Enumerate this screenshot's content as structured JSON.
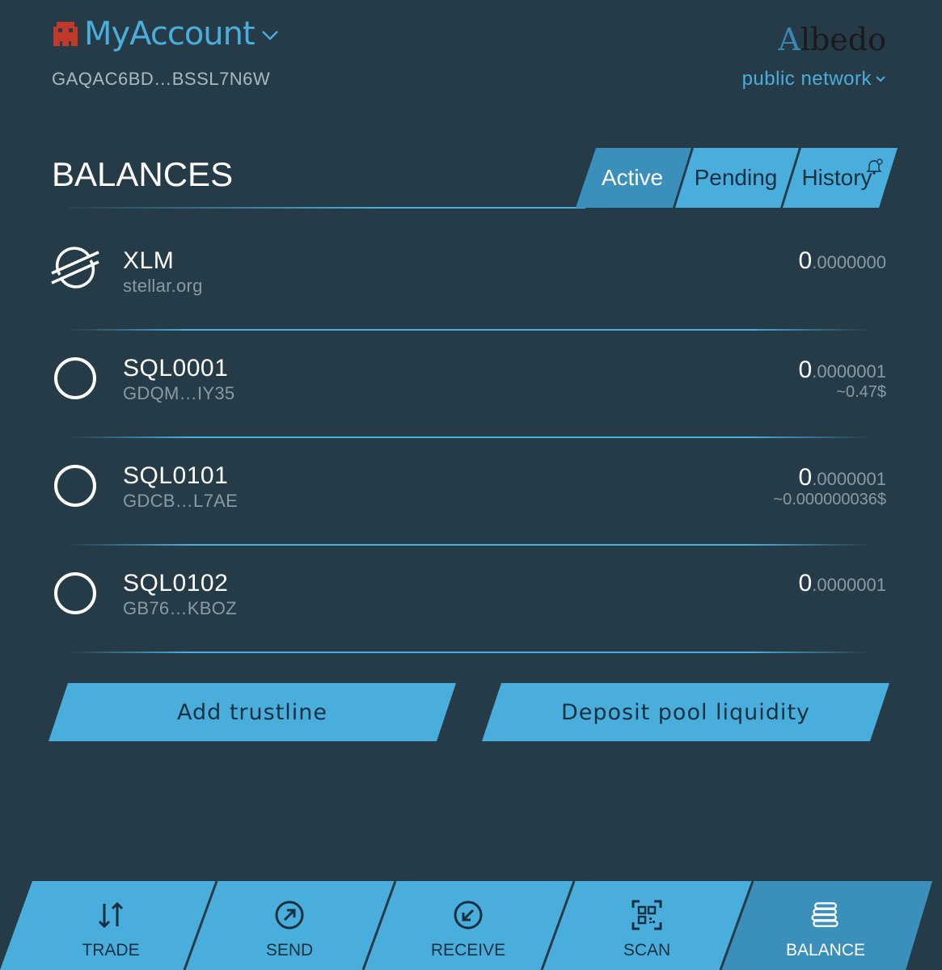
{
  "account": {
    "name": "MyAccount",
    "address": "GAQAC6BD…BSSL7N6W"
  },
  "brand": {
    "first": "A",
    "rest": "lbedo"
  },
  "network": {
    "label": "public network"
  },
  "balances": {
    "title": "BALANCES",
    "tabs": [
      {
        "label": "Active",
        "selected": true
      },
      {
        "label": "Pending",
        "selected": false
      },
      {
        "label": "History",
        "selected": false
      }
    ],
    "assets": [
      {
        "code": "XLM",
        "issuer": "stellar.org",
        "amount_int": "0",
        "amount_frac": ".0000000",
        "usd": "",
        "icon": "stellar-logo-icon"
      },
      {
        "code": "SQL0001",
        "issuer": "GDQM…IY35",
        "amount_int": "0",
        "amount_frac": ".0000001",
        "usd": "~0.47$",
        "icon": "circle-asset-icon"
      },
      {
        "code": "SQL0101",
        "issuer": "GDCB…L7AE",
        "amount_int": "0",
        "amount_frac": ".0000001",
        "usd": "~0.000000036$",
        "icon": "circle-asset-icon"
      },
      {
        "code": "SQL0102",
        "issuer": "GB76…KBOZ",
        "amount_int": "0",
        "amount_frac": ".0000001",
        "usd": "",
        "icon": "circle-asset-icon"
      }
    ]
  },
  "actions": {
    "add_trustline": "Add trustline",
    "deposit_liquidity": "Deposit pool liquidity"
  },
  "nav": [
    {
      "label": "TRADE",
      "icon": "trade-arrows-icon",
      "active": false
    },
    {
      "label": "SEND",
      "icon": "send-icon",
      "active": false
    },
    {
      "label": "RECEIVE",
      "icon": "receive-icon",
      "active": false
    },
    {
      "label": "SCAN",
      "icon": "qr-scan-icon",
      "active": false
    },
    {
      "label": "BALANCE",
      "icon": "balance-stack-icon",
      "active": true
    }
  ],
  "colors": {
    "background": "#253c48",
    "accent": "#4aaedd",
    "accent_dark": "#3a8fbb",
    "text_muted": "#8a9aa4"
  }
}
